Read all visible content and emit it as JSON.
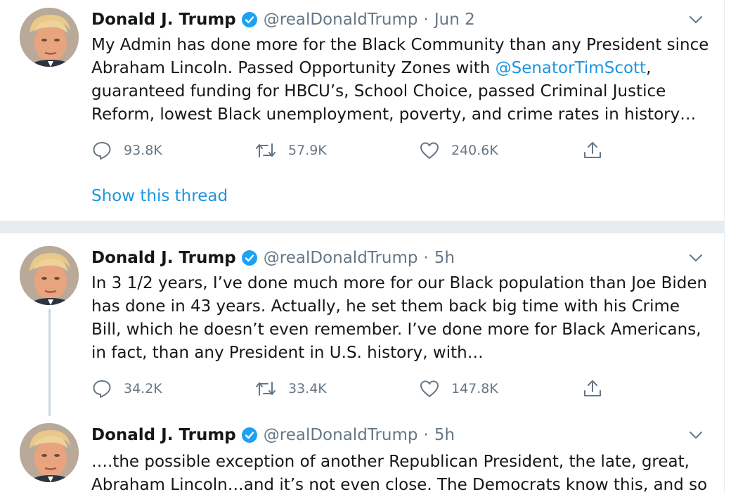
{
  "tweets": [
    {
      "name": "Donald J. Trump",
      "handle": "@realDonaldTrump",
      "separator": "·",
      "time": "Jun 2",
      "text_parts": [
        "My Admin has done more for the Black Community than any President since Abraham Lincoln. Passed Opportunity Zones with ",
        "@SenatorTimScott",
        ", guaranteed funding for HBCU’s, School Choice, passed Criminal Justice Reform, lowest Black unemployment, poverty, and crime rates in history…"
      ],
      "replies": "93.8K",
      "retweets": "57.9K",
      "likes": "240.6K",
      "show_thread": "Show this thread"
    },
    {
      "name": "Donald J. Trump",
      "handle": "@realDonaldTrump",
      "separator": "·",
      "time": "5h",
      "text": "In 3 1/2 years, I’ve done much more for our Black population than Joe Biden has done in 43 years. Actually, he set them back big time with his Crime Bill, which he doesn’t even remember. I’ve done more for Black Americans, in fact, than any President in U.S. history, with…",
      "replies": "34.2K",
      "retweets": "33.4K",
      "likes": "147.8K"
    },
    {
      "name": "Donald J. Trump",
      "handle": "@realDonaldTrump",
      "separator": "·",
      "time": "5h",
      "text": "….the possible exception of another Republican President, the late, great, Abraham Lincoln…and it’s not even close. The Democrats know this, and so"
    }
  ],
  "icons": {
    "reply": "reply-icon",
    "retweet": "retweet-icon",
    "like": "like-icon",
    "share": "share-icon",
    "verified": "verified-badge-icon",
    "caret": "chevron-down-icon"
  },
  "colors": {
    "link": "#1b95e0",
    "verified": "#1da1f2",
    "secondary_text": "#657786",
    "separator": "#e6ecf0"
  }
}
